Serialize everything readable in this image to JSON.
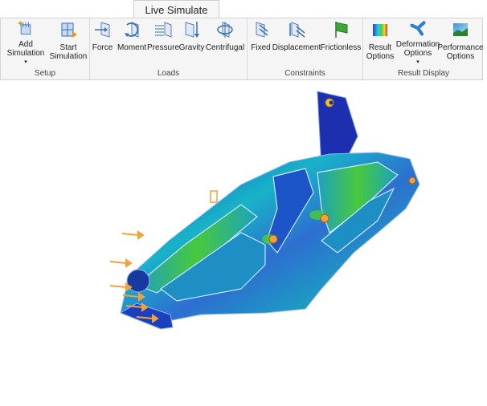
{
  "ribbon": {
    "active_tab": "Live Simulate",
    "groups": {
      "setup": "Setup",
      "loads": "Loads",
      "constraints": "Constraints",
      "result_display": "Result Display"
    },
    "buttons": {
      "add_simulation": [
        "Add",
        "Simulation"
      ],
      "start_simulation": [
        "Start",
        "Simulation"
      ],
      "force": "Force",
      "moment": "Moment",
      "pressure": "Pressure",
      "gravity": "Gravity",
      "centrifugal": "Centrifugal",
      "fixed": "Fixed",
      "displacement": "Displacement",
      "frictionless": "Frictionless",
      "result_options": [
        "Result",
        "Options"
      ],
      "deformation_options": [
        "Deformation",
        "Options"
      ],
      "performance_options": [
        "Performance",
        "Options"
      ]
    },
    "dropdown_caret": "▾"
  },
  "viewport": {
    "model": "bracket-part",
    "colors": {
      "stress_low": "#1a3fbf",
      "stress_mid": "#18b3c8",
      "stress_high": "#48c93c",
      "load_arrow": "#f2a23a"
    }
  }
}
